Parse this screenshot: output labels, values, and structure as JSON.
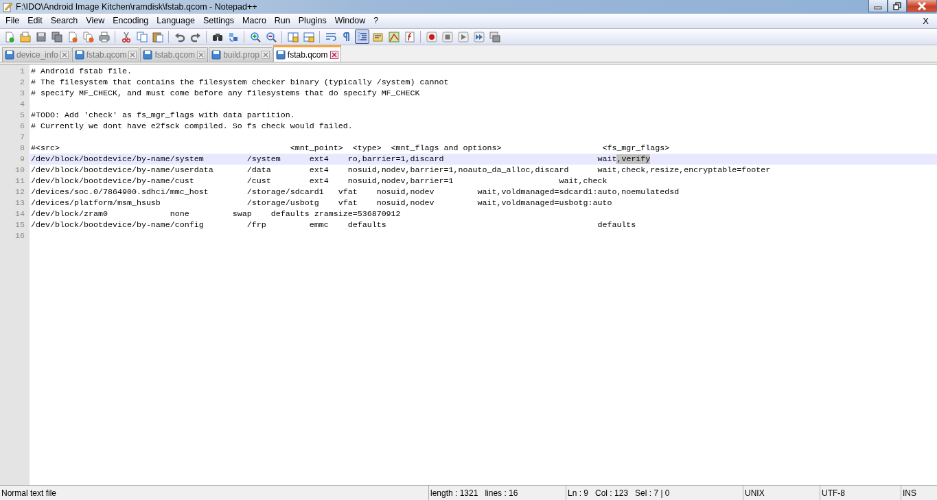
{
  "window": {
    "title": "F:\\IDO\\Android Image Kitchen\\ramdisk\\fstab.qcom - Notepad++"
  },
  "menu": [
    "File",
    "Edit",
    "Search",
    "View",
    "Encoding",
    "Language",
    "Settings",
    "Macro",
    "Run",
    "Plugins",
    "Window",
    "?"
  ],
  "menu_close": "X",
  "toolbar": [
    {
      "kind": "new",
      "pressed": false
    },
    {
      "kind": "open",
      "pressed": false
    },
    {
      "kind": "save",
      "pressed": false
    },
    {
      "kind": "saveall",
      "pressed": false
    },
    {
      "kind": "close",
      "pressed": false
    },
    {
      "kind": "closeall",
      "pressed": false
    },
    {
      "kind": "print",
      "pressed": false
    },
    {
      "kind": "sep"
    },
    {
      "kind": "cut",
      "pressed": false
    },
    {
      "kind": "copy",
      "pressed": false
    },
    {
      "kind": "paste",
      "pressed": false
    },
    {
      "kind": "sep"
    },
    {
      "kind": "undo",
      "pressed": false
    },
    {
      "kind": "redo",
      "pressed": false
    },
    {
      "kind": "sep"
    },
    {
      "kind": "find",
      "pressed": false
    },
    {
      "kind": "replace",
      "pressed": false
    },
    {
      "kind": "sep"
    },
    {
      "kind": "zoomin",
      "pressed": false
    },
    {
      "kind": "zoomout",
      "pressed": false
    },
    {
      "kind": "sep"
    },
    {
      "kind": "syncv",
      "pressed": false
    },
    {
      "kind": "synch",
      "pressed": false
    },
    {
      "kind": "sep"
    },
    {
      "kind": "wrap",
      "pressed": false
    },
    {
      "kind": "pilcrow",
      "pressed": false
    },
    {
      "kind": "indent",
      "pressed": true
    },
    {
      "kind": "udl",
      "pressed": false
    },
    {
      "kind": "map",
      "pressed": false
    },
    {
      "kind": "func",
      "pressed": false
    },
    {
      "kind": "sep"
    },
    {
      "kind": "record",
      "pressed": false
    },
    {
      "kind": "stop",
      "pressed": false
    },
    {
      "kind": "play",
      "pressed": false
    },
    {
      "kind": "playmany",
      "pressed": false
    },
    {
      "kind": "savemacro",
      "pressed": false
    }
  ],
  "tabs": [
    {
      "label": "device_info",
      "selected": false
    },
    {
      "label": "fstab.qcom",
      "selected": false
    },
    {
      "label": "fstab.qcom",
      "selected": false
    },
    {
      "label": "build.prop",
      "selected": false
    },
    {
      "label": "fstab.qcom",
      "selected": true
    }
  ],
  "lines": [
    {
      "number": "1",
      "text": "# Android fstab file.",
      "current": false
    },
    {
      "number": "2",
      "text": "# The filesystem that contains the filesystem checker binary (typically /system) cannot",
      "current": false
    },
    {
      "number": "3",
      "text": "# specify MF_CHECK, and must come before any filesystems that do specify MF_CHECK",
      "current": false
    },
    {
      "number": "4",
      "current": false
    },
    {
      "number": "5",
      "text": "#TODO: Add 'check' as fs_mgr_flags with data partition.",
      "current": false
    },
    {
      "number": "6",
      "text": "# Currently we dont have e2fsck compiled. So fs check would failed.",
      "current": false
    },
    {
      "number": "7",
      "current": false
    },
    {
      "number": "8",
      "text": "#<src>                                                <mnt_point>  <type>  <mnt_flags and options>                     <fs_mgr_flags>",
      "current": false
    },
    {
      "number": "9",
      "segments": [
        {
          "text": "/dev/block/bootdevice/by-name/system         /system      ext4    ro,barrier=1,discard                                wait",
          "selected": false
        },
        {
          "text": ",verify",
          "selected": true
        }
      ],
      "current": true
    },
    {
      "number": "10",
      "text": "/dev/block/bootdevice/by-name/userdata       /data        ext4    nosuid,nodev,barrier=1,noauto_da_alloc,discard      wait,check,resize,encryptable=footer",
      "current": false
    },
    {
      "number": "11",
      "text": "/dev/block/bootdevice/by-name/cust           /cust        ext4    nosuid,nodev,barrier=1                      wait,check",
      "current": false
    },
    {
      "number": "12",
      "text": "/devices/soc.0/7864900.sdhci/mmc_host        /storage/sdcard1   vfat    nosuid,nodev         wait,voldmanaged=sdcard1:auto,noemulatedsd",
      "current": false
    },
    {
      "number": "13",
      "text": "/devices/platform/msm_hsusb                  /storage/usbotg    vfat    nosuid,nodev         wait,voldmanaged=usbotg:auto",
      "current": false
    },
    {
      "number": "14",
      "text": "/dev/block/zram0             none         swap    defaults zramsize=536870912",
      "current": false
    },
    {
      "number": "15",
      "text": "/dev/block/bootdevice/by-name/config         /frp         emmc    defaults                                            defaults",
      "current": false
    },
    {
      "number": "16",
      "current": false
    }
  ],
  "status_bar": {
    "file_type": "Normal text file",
    "length": "length : 1321",
    "lines": "lines : 16",
    "position": "Ln : 9",
    "column": "Col : 123",
    "selection": "Sel : 7 | 0",
    "eol": "UNIX",
    "encoding": "UTF-8",
    "mode": "INS"
  }
}
